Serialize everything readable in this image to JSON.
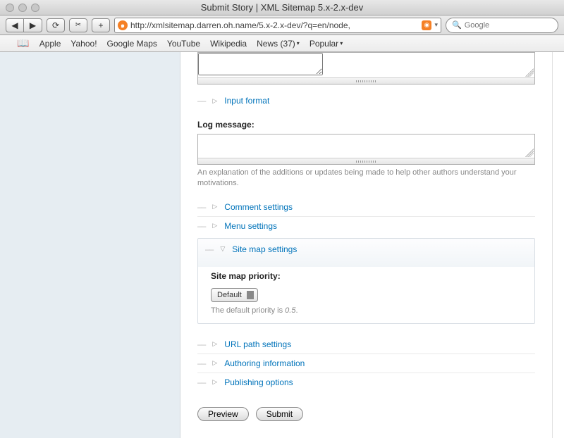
{
  "window": {
    "title": "Submit Story | XML Sitemap 5.x-2.x-dev"
  },
  "toolbar": {
    "url": "http://xmlsitemap.darren.oh.name/5.x-2.x-dev/?q=en/node,",
    "search_placeholder": "Google"
  },
  "bookmarks": {
    "items": [
      "Apple",
      "Yahoo!",
      "Google Maps",
      "YouTube",
      "Wikipedia",
      "News (37)",
      "Popular"
    ]
  },
  "fieldsets": {
    "input_format": "Input format",
    "comment_settings": "Comment settings",
    "menu_settings": "Menu settings",
    "sitemap_settings": "Site map settings",
    "url_path": "URL path settings",
    "authoring": "Authoring information",
    "publishing": "Publishing options"
  },
  "log": {
    "label": "Log message:",
    "help": "An explanation of the additions or updates being made to help other authors understand your motivations."
  },
  "sitemap": {
    "priority_label": "Site map priority:",
    "selected": "Default",
    "desc_prefix": "The default priority is ",
    "desc_value": "0.5",
    "desc_suffix": "."
  },
  "actions": {
    "preview": "Preview",
    "submit": "Submit"
  }
}
